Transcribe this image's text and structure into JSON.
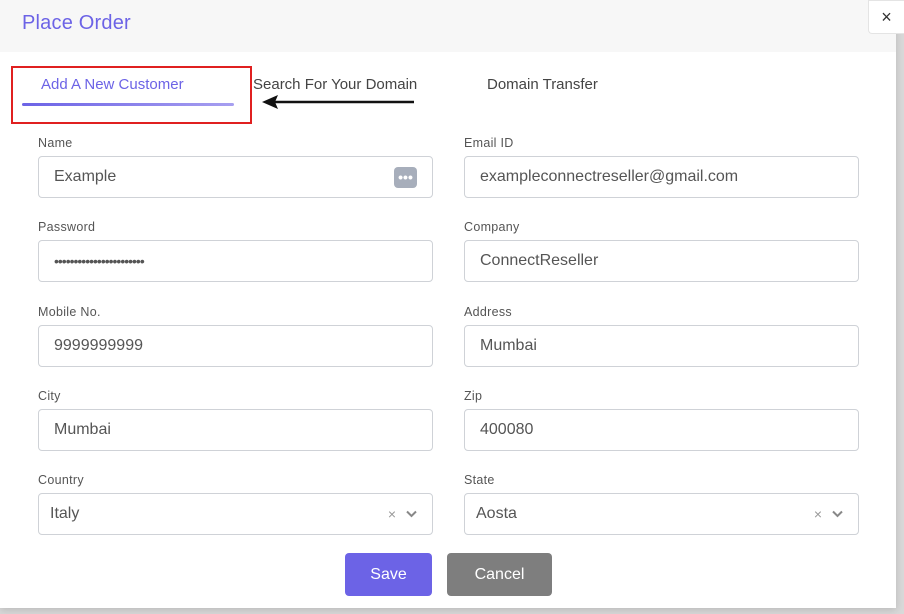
{
  "modal": {
    "title": "Place Order",
    "close_symbol": "×"
  },
  "tabs": [
    {
      "label": "Add A New Customer",
      "active": true
    },
    {
      "label": "Search For Your Domain",
      "active": false
    },
    {
      "label": "Domain Transfer",
      "active": false
    }
  ],
  "form": {
    "name": {
      "label": "Name",
      "value": "Example"
    },
    "email": {
      "label": "Email ID",
      "value": "exampleconnectreseller@gmail.com"
    },
    "password": {
      "label": "Password",
      "value": "•••••••••••••••••••••••"
    },
    "company": {
      "label": "Company",
      "value": "ConnectReseller"
    },
    "mobile": {
      "label": "Mobile No.",
      "value": "9999999999"
    },
    "address": {
      "label": "Address",
      "value": "Mumbai"
    },
    "city": {
      "label": "City",
      "value": "Mumbai"
    },
    "zip": {
      "label": "Zip",
      "value": "400080"
    },
    "country": {
      "label": "Country",
      "value": "Italy"
    },
    "state": {
      "label": "State",
      "value": "Aosta"
    }
  },
  "buttons": {
    "save": "Save",
    "cancel": "Cancel"
  },
  "icons": {
    "password_manager": "dots-icon",
    "clear": "×"
  },
  "colors": {
    "accent": "#6c63e6",
    "highlight": "#e02020",
    "cancel": "#7e7e7e"
  }
}
